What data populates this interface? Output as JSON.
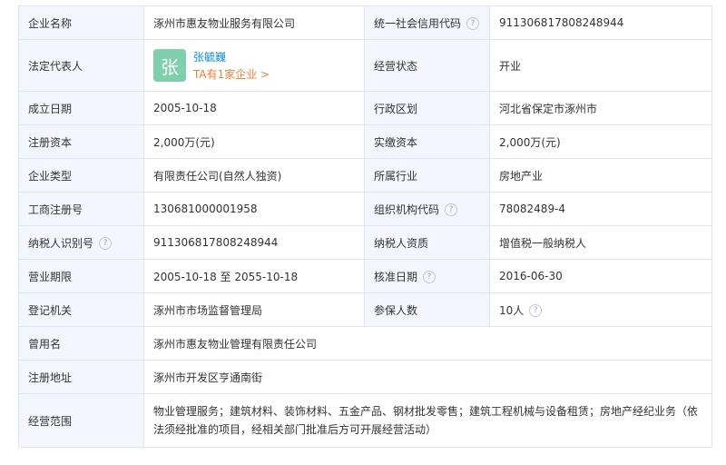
{
  "rows": [
    {
      "l1": "企业名称",
      "v1": "涿州市惠友物业服务有限公司",
      "l2": "统一社会信用代码",
      "v2": "911306817808248944"
    },
    {
      "l1": "法定代表人",
      "rep_avatar": "张",
      "rep_name": "张毓巍",
      "rep_link": "TA有1家企业 >",
      "l2": "经营状态",
      "v2": "开业"
    },
    {
      "l1": "成立日期",
      "v1": "2005-10-18",
      "l2": "行政区划",
      "v2": "河北省保定市涿州市"
    },
    {
      "l1": "注册资本",
      "v1": "2,000万(元)",
      "l2": "实缴资本",
      "v2": "2,000万(元)"
    },
    {
      "l1": "企业类型",
      "v1": "有限责任公司(自然人独资)",
      "l2": "所属行业",
      "v2": "房地产业"
    },
    {
      "l1": "工商注册号",
      "v1": "130681000001958",
      "l2": "组织机构代码",
      "v2": "78082489-4"
    },
    {
      "l1": "纳税人识别号",
      "v1": "911306817808248944",
      "l2": "纳税人资质",
      "v2": "增值税一般纳税人"
    },
    {
      "l1": "营业期限",
      "v1": "2005-10-18 至 2055-10-18",
      "l2": "核准日期",
      "v2": "2016-06-30"
    },
    {
      "l1": "登记机关",
      "v1": "涿州市市场监督管理局",
      "l2": "参保人数",
      "v2": "10人"
    },
    {
      "l1": "曾用名",
      "v1": "涿州市惠友物业管理有限责任公司"
    },
    {
      "l1": "注册地址",
      "v1": "涿州市开发区亨通南街"
    },
    {
      "l1": "经营范围",
      "v1": "物业管理服务；建筑材料、装饰材料、五金产品、钢材批发零售；建筑工程机械与设备租赁；房地产经纪业务（依法须经批准的项目，经相关部门批准后方可开展经营活动）"
    }
  ],
  "help_glyph": "?",
  "colors": {
    "label_bg": "#f3f7fd",
    "border": "#dde6f2",
    "link_blue": "#128bed",
    "link_orange": "#fd7b33",
    "avatar_bg": "#7fcfad"
  }
}
